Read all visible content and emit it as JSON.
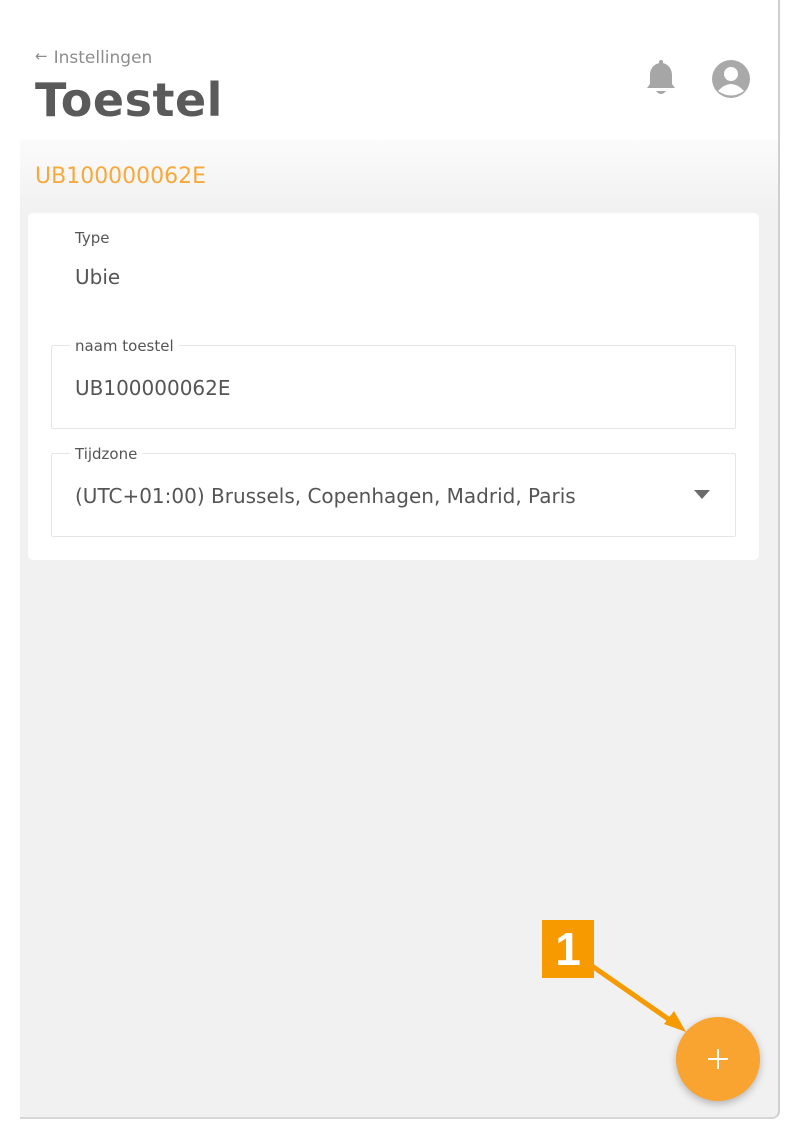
{
  "header": {
    "back_label": "Instellingen",
    "back_icon": "arrow-left-icon",
    "title": "Toestel",
    "icons": [
      "bell-icon",
      "user-avatar-icon"
    ]
  },
  "device_id": "UB100000062E",
  "card": {
    "type_label": "Type",
    "type_value": "Ubie",
    "name_field": {
      "label": "naam toestel",
      "value": "UB100000062E"
    },
    "timezone_field": {
      "label": "Tijdzone",
      "value": "(UTC+01:00) Brussels, Copenhagen, Madrid, Paris"
    }
  },
  "fab": {
    "icon": "plus-icon"
  },
  "annotation": {
    "number": "1",
    "color": "#f79a00"
  },
  "colors": {
    "accent": "#f9a330",
    "device_id_text": "#f7a93b",
    "background": "#f1f1f1"
  }
}
